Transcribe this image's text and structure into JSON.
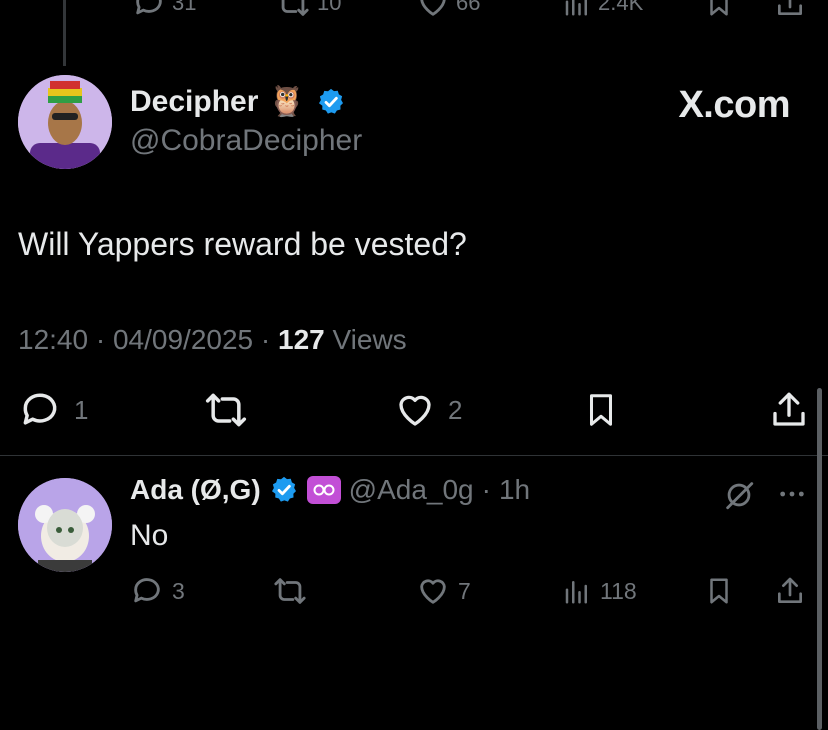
{
  "previous_tweet_actions": {
    "reply_count": "31",
    "retweet_count": "10",
    "like_count": "66",
    "view_count": "2.4K"
  },
  "tweet": {
    "author_name": "Decipher",
    "author_emoji": "🦉",
    "author_handle": "@CobraDecipher",
    "source_label": "X.com",
    "text": "Will Yappers reward be vested?",
    "time": "12:40",
    "date": "04/09/2025",
    "separator": "·",
    "views_count": "127",
    "views_label": "Views",
    "actions": {
      "reply_count": "1",
      "like_count": "2"
    }
  },
  "reply": {
    "author_name": "Ada (Ø,G)",
    "author_handle": "@Ada_0g",
    "time_ago": "1h",
    "separator": "·",
    "text": "No",
    "actions": {
      "reply_count": "3",
      "like_count": "7",
      "view_count": "118"
    }
  },
  "colors": {
    "background": "#000000",
    "text": "#e7e9ea",
    "muted": "#71767b",
    "verified_blue": "#1d9bf0",
    "affiliate_badge": "#c24fd6"
  },
  "icons": [
    "reply-icon",
    "retweet-icon",
    "like-icon",
    "views-icon",
    "bookmark-icon",
    "share-icon",
    "verified-badge-icon",
    "owl-emoji-icon",
    "grok-icon",
    "more-icon",
    "affiliate-badge-icon"
  ]
}
